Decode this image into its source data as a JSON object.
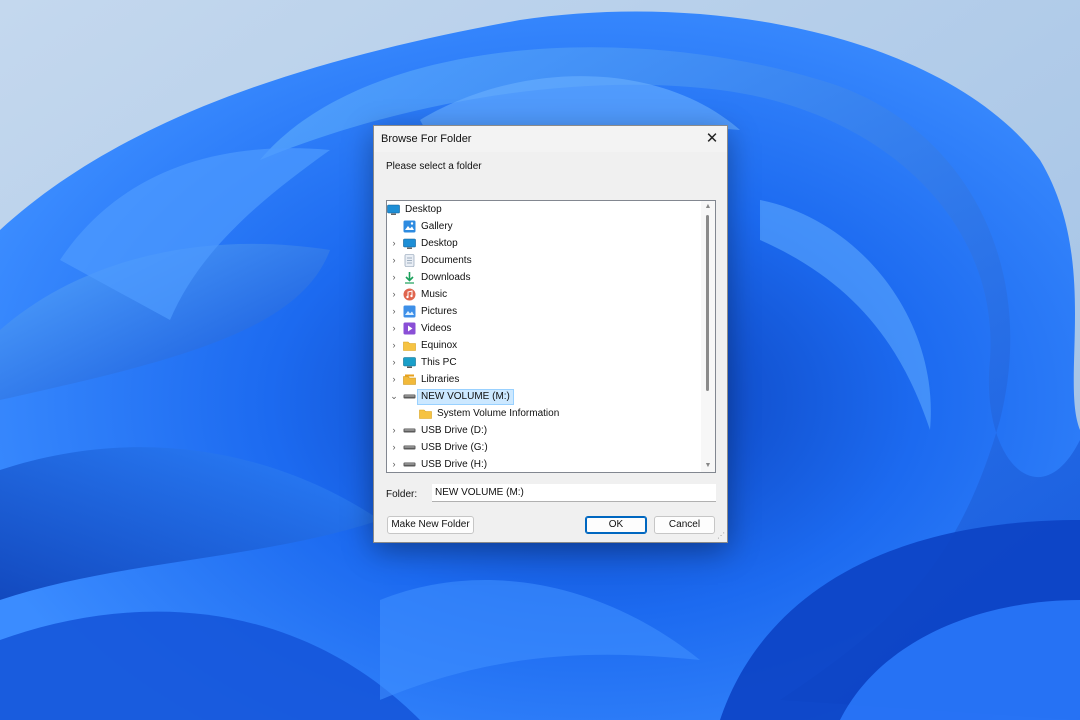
{
  "dialog": {
    "title": "Browse For Folder",
    "close_symbol": "✕",
    "prompt": "Please select a folder",
    "tree": [
      {
        "label": "Desktop",
        "icon": "desktop-icon",
        "level": 0,
        "expander": "",
        "selected": false
      },
      {
        "label": "Gallery",
        "icon": "gallery-icon",
        "level": 1,
        "expander": "",
        "selected": false
      },
      {
        "label": "Desktop",
        "icon": "desktop-icon",
        "level": 1,
        "expander": "›",
        "selected": false
      },
      {
        "label": "Documents",
        "icon": "documents-icon",
        "level": 1,
        "expander": "›",
        "selected": false
      },
      {
        "label": "Downloads",
        "icon": "downloads-icon",
        "level": 1,
        "expander": "›",
        "selected": false
      },
      {
        "label": "Music",
        "icon": "music-icon",
        "level": 1,
        "expander": "›",
        "selected": false
      },
      {
        "label": "Pictures",
        "icon": "pictures-icon",
        "level": 1,
        "expander": "›",
        "selected": false
      },
      {
        "label": "Videos",
        "icon": "videos-icon",
        "level": 1,
        "expander": "›",
        "selected": false
      },
      {
        "label": "Equinox",
        "icon": "folder-icon",
        "level": 1,
        "expander": "›",
        "selected": false
      },
      {
        "label": "This PC",
        "icon": "computer-icon",
        "level": 1,
        "expander": "›",
        "selected": false
      },
      {
        "label": "Libraries",
        "icon": "libraries-icon",
        "level": 1,
        "expander": "›",
        "selected": false
      },
      {
        "label": "NEW VOLUME (M:)",
        "icon": "drive-icon",
        "level": 1,
        "expander": "⌄",
        "selected": true
      },
      {
        "label": "System Volume Information",
        "icon": "folder-icon",
        "level": 2,
        "expander": "",
        "selected": false
      },
      {
        "label": "USB Drive (D:)",
        "icon": "drive-icon",
        "level": 1,
        "expander": "›",
        "selected": false
      },
      {
        "label": "USB Drive (G:)",
        "icon": "drive-icon",
        "level": 1,
        "expander": "›",
        "selected": false
      },
      {
        "label": "USB Drive (H:)",
        "icon": "drive-icon",
        "level": 1,
        "expander": "›",
        "selected": false
      }
    ],
    "scroll_up_symbol": "▲",
    "scroll_down_symbol": "▼",
    "folder_label": "Folder:",
    "folder_value": "NEW VOLUME (M:)",
    "make_new_folder_label": "Make New Folder",
    "ok_label": "OK",
    "cancel_label": "Cancel",
    "grip_symbol": "⋰"
  },
  "colors": {
    "accent": "#0067c0",
    "wallpaper_sky": "#a8c8ea",
    "wallpaper_blue": "#1a5fe0"
  }
}
